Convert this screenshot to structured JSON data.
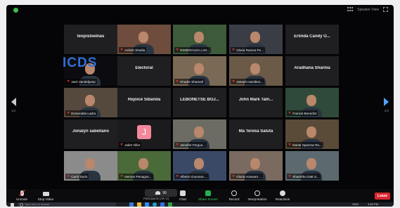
{
  "window": {
    "speaker_view_label": "Speaker View"
  },
  "branding": {
    "logo_text": "ICDS"
  },
  "pagination": {
    "left_page": "1/2",
    "right_page": "1/2"
  },
  "tiles": [
    {
      "name": "teopistoelnas",
      "type": "name-only"
    },
    {
      "name": "Ashish Shukla",
      "type": "video",
      "muted": true,
      "bg": "#6e4d3e"
    },
    {
      "name": "ESMERALDA LAD...",
      "type": "video",
      "muted": true,
      "bg": "#3d5a3a"
    },
    {
      "name": "Gloria Ramos Pe...",
      "type": "video",
      "muted": true,
      "bg": "#3a3d45"
    },
    {
      "name": "Erlinda Candy O...",
      "type": "name-only"
    },
    {
      "name": "Jack Vandeljump",
      "type": "video",
      "muted": true,
      "bg": "#0c0c10"
    },
    {
      "name": "Electoral",
      "type": "name-only"
    },
    {
      "name": "Khader Shamali",
      "type": "video",
      "muted": true,
      "bg": "#7a6a55"
    },
    {
      "name": "Joseph Hamilton...",
      "type": "video",
      "muted": true,
      "bg": "#6b5a48"
    },
    {
      "name": "Aradhana Sharma",
      "type": "name-only"
    },
    {
      "name": "Esmeralda Ladra",
      "type": "video",
      "muted": true,
      "bg": "#55483c"
    },
    {
      "name": "Rejoice Sibanda",
      "type": "name-only"
    },
    {
      "name": "LEBONETSE BOJ...",
      "type": "name-only"
    },
    {
      "name": "John Mark Tam...",
      "type": "name-only"
    },
    {
      "name": "Francis Benedict",
      "type": "video",
      "muted": true,
      "bg": "#2f4a3a"
    },
    {
      "name": "Jonalyn sabellano",
      "type": "name-only"
    },
    {
      "name": "Juliet Villar",
      "type": "avatar",
      "muted": true,
      "initial": "J"
    },
    {
      "name": "Jennifer Fergus...",
      "type": "video",
      "muted": true,
      "bg": "#6c6c64"
    },
    {
      "name": "Ma Teresa Saluta",
      "type": "name-only"
    },
    {
      "name": "Dante Sparrow Ra...",
      "type": "video",
      "muted": true,
      "bg": "#5a4a38"
    },
    {
      "name": "Carol Durin",
      "type": "video",
      "muted": true,
      "bg": "#8b8b8b"
    },
    {
      "name": "Hernan Penagos...",
      "type": "video",
      "muted": true,
      "bg": "#4a6a3a"
    },
    {
      "name": "Alberto Guevara ...",
      "type": "video",
      "muted": true,
      "bg": "#3a4a66"
    },
    {
      "name": "Gloria Aramant ...",
      "type": "video",
      "muted": true,
      "bg": "#7a6a60"
    },
    {
      "name": "Shambhu Datt S...",
      "type": "video",
      "muted": true,
      "bg": "#5c6a70"
    }
  ],
  "toolbar": {
    "unmute": "Unmute",
    "stop_video": "Stop Video",
    "participants_count": "99",
    "participants_tip": "Participants (Alt+U)",
    "chat": "Chat",
    "share_screen": "Share Screen",
    "record": "Record",
    "interpretation": "Interpretation",
    "reactions": "Reactions",
    "leave": "Leave"
  },
  "taskbar": {
    "search_placeholder": "Type here to search",
    "language": "ENG",
    "time": "3:55 PM"
  },
  "colors": {
    "accent": "#2f6fd6",
    "share_green": "#25b14f",
    "leave_red": "#d9272e",
    "mute_red": "#ff3a3a"
  }
}
